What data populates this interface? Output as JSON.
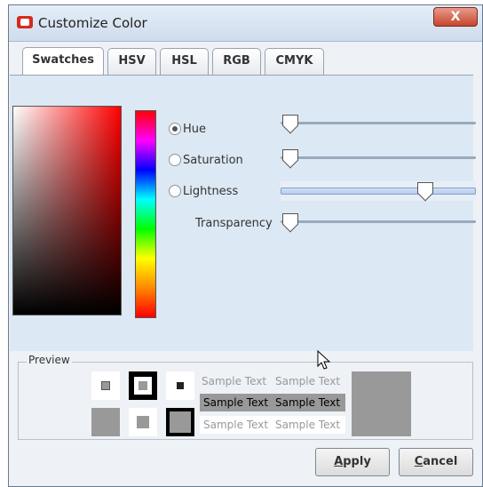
{
  "window": {
    "title": "Customize Color",
    "close_label": "X"
  },
  "tabs": [
    {
      "label": "Swatches",
      "active": true
    },
    {
      "label": "HSV",
      "active": false
    },
    {
      "label": "HSL",
      "active": false
    },
    {
      "label": "RGB",
      "active": false
    },
    {
      "label": "CMYK",
      "active": false
    }
  ],
  "hsl": {
    "hue_label": "Hue",
    "saturation_label": "Saturation",
    "lightness_label": "Lightness",
    "transparency_label": "Transparency",
    "selected": "Hue",
    "hue_value": 0,
    "saturation_value": 0,
    "lightness_value": 0.75,
    "transparency_value": 0
  },
  "preview": {
    "label": "Preview",
    "sample_text": "Sample Text"
  },
  "buttons": {
    "apply": {
      "first": "A",
      "rest": "pply"
    },
    "cancel": {
      "first": "C",
      "rest": "ancel"
    }
  }
}
